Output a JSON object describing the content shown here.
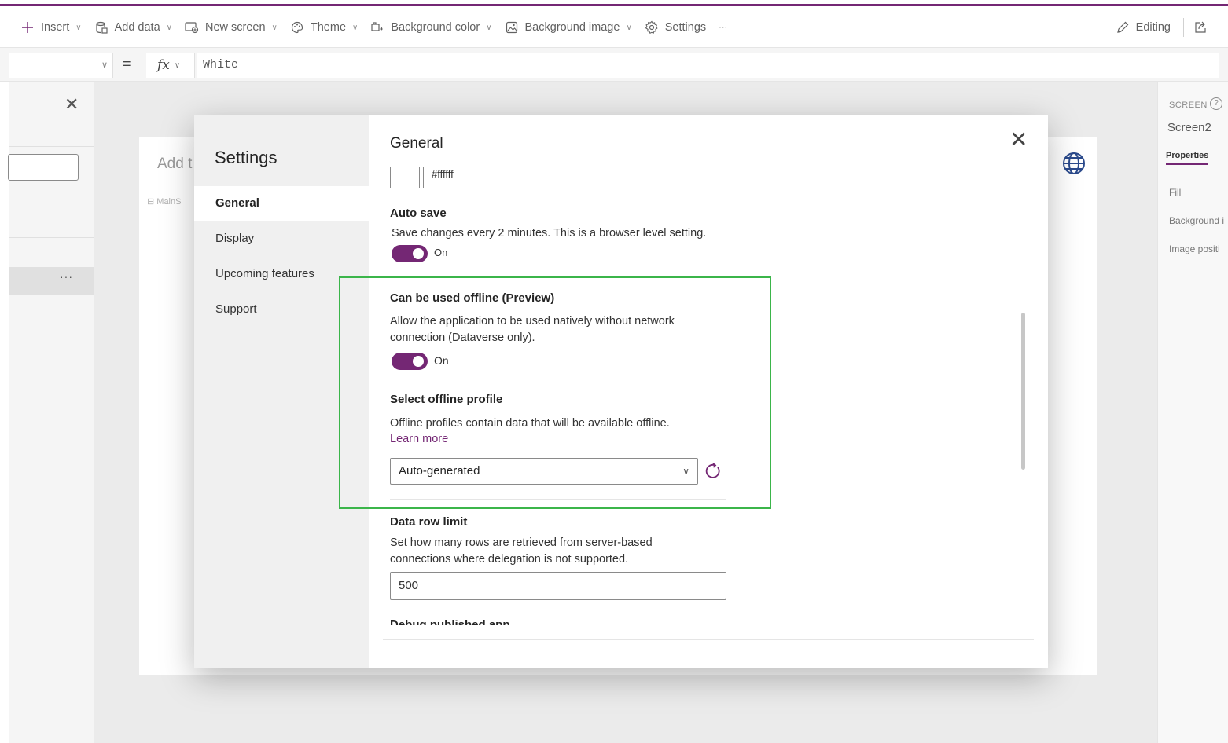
{
  "toolbar": {
    "items": [
      {
        "label": "Insert",
        "icon": "plus-icon"
      },
      {
        "label": "Add data",
        "icon": "database-icon"
      },
      {
        "label": "New screen",
        "icon": "new-screen-icon"
      },
      {
        "label": "Theme",
        "icon": "palette-icon"
      },
      {
        "label": "Background color",
        "icon": "fill-icon"
      },
      {
        "label": "Background image",
        "icon": "image-icon"
      }
    ],
    "settings_label": "Settings",
    "more_label": "···",
    "editing_label": "Editing"
  },
  "formula": {
    "equals": "=",
    "fx": "fx",
    "value": "White"
  },
  "leftpane": {
    "close": "✕",
    "more": "···"
  },
  "canvas": {
    "add_text": "Add t",
    "main_label": "MainS"
  },
  "rightpane": {
    "screen_label": "SCREEN",
    "help": "?",
    "screen_name": "Screen2",
    "tab": "Properties",
    "props": [
      "Fill",
      "Background i",
      "Image positi"
    ]
  },
  "settings": {
    "title": "Settings",
    "close": "✕",
    "nav": [
      "General",
      "Display",
      "Upcoming features",
      "Support"
    ],
    "section_title": "General",
    "color_value": "#ffffff",
    "autosave": {
      "label": "Auto save",
      "description": "Save changes every 2 minutes. This is a browser level setting.",
      "state": "On"
    },
    "offline": {
      "label": "Can be used offline (Preview)",
      "description_line1": "Allow the application to be used natively without network",
      "description_line2": "connection (Dataverse only).",
      "state": "On"
    },
    "offline_profile": {
      "label": "Select offline profile",
      "description": "Offline profiles contain data that will be available offline.",
      "link": "Learn more",
      "selected": "Auto-generated"
    },
    "row_limit": {
      "label": "Data row limit",
      "description_line1": "Set how many rows are retrieved from server-based",
      "description_line2": "connections where delegation is not supported.",
      "value": "500"
    },
    "debug_label": "Debug published app"
  },
  "colors": {
    "accent": "#742774",
    "highlight": "#3bb54a"
  }
}
